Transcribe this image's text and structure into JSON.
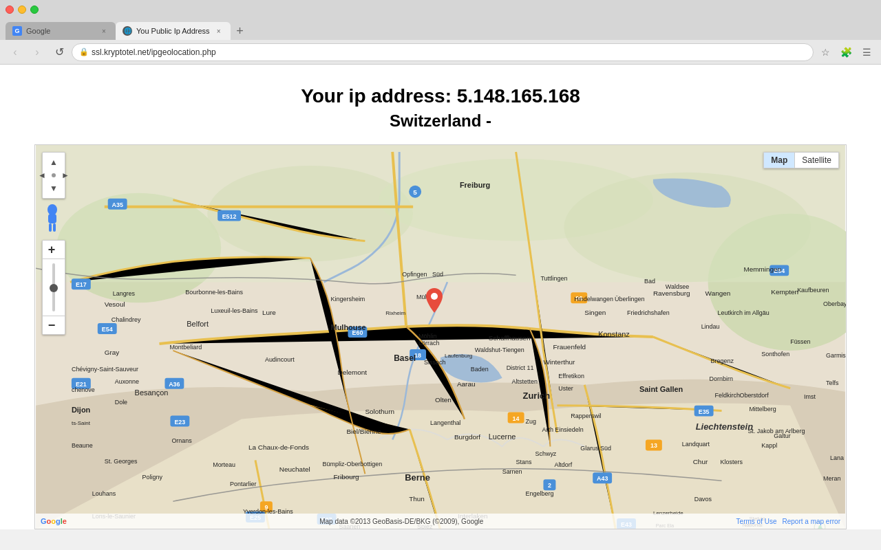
{
  "browser": {
    "tabs": [
      {
        "id": "google",
        "label": "Google",
        "favicon": "G",
        "active": false,
        "close": "×"
      },
      {
        "id": "ip",
        "label": "You Public Ip Address",
        "favicon": "🌐",
        "active": true,
        "close": "×"
      }
    ],
    "nav": {
      "back_title": "Back",
      "forward_title": "Forward",
      "reload_title": "Reload",
      "url": "ssl.kryptotel.net/ipgeolocation.php",
      "bookmark_title": "Bookmark",
      "extensions_title": "Extensions",
      "menu_title": "Menu"
    }
  },
  "page": {
    "ip_line1": "Your ip address: 5.148.165.168",
    "ip_line2": "Switzerland -",
    "map": {
      "type_buttons": [
        "Map",
        "Satellite"
      ],
      "active_type": "Map",
      "footer_data": "Map data ©2013 GeoBasis-DE/BKG (©2009), Google",
      "footer_terms": "Terms of Use",
      "footer_report": "Report a map error",
      "zoom_plus": "+",
      "zoom_minus": "−"
    }
  }
}
